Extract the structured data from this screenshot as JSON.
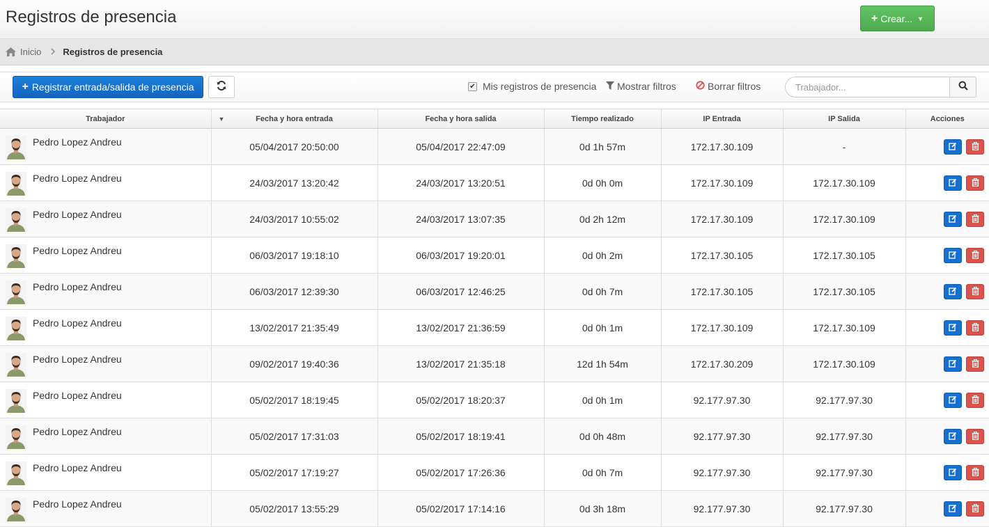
{
  "header": {
    "title": "Registros de presencia",
    "create_label": "Crear..."
  },
  "breadcrumb": {
    "home": "Inicio",
    "current": "Registros de presencia"
  },
  "toolbar": {
    "register_label": "Registrar entrada/salida de presencia",
    "my_records_label": "Mis registros de presencia",
    "my_records_checked": true,
    "show_filters_label": "Mostrar filtros",
    "clear_filters_label": "Borrar filtros",
    "search_placeholder": "Trabajador..."
  },
  "table": {
    "columns": [
      "Trabajador",
      "Fecha y hora entrada",
      "Fecha y hora salida",
      "Tiempo realizado",
      "IP Entrada",
      "IP Salida",
      "Acciones"
    ],
    "rows": [
      {
        "worker": "Pedro Lopez Andreu",
        "entry": "05/04/2017 20:50:00",
        "exit": "05/04/2017 22:47:09",
        "time": "0d 1h 57m",
        "ip_in": "172.17.30.109",
        "ip_out": "-"
      },
      {
        "worker": "Pedro Lopez Andreu",
        "entry": "24/03/2017 13:20:42",
        "exit": "24/03/2017 13:20:51",
        "time": "0d 0h 0m",
        "ip_in": "172.17.30.109",
        "ip_out": "172.17.30.109"
      },
      {
        "worker": "Pedro Lopez Andreu",
        "entry": "24/03/2017 10:55:02",
        "exit": "24/03/2017 13:07:35",
        "time": "0d 2h 12m",
        "ip_in": "172.17.30.109",
        "ip_out": "172.17.30.109"
      },
      {
        "worker": "Pedro Lopez Andreu",
        "entry": "06/03/2017 19:18:10",
        "exit": "06/03/2017 19:20:01",
        "time": "0d 0h 2m",
        "ip_in": "172.17.30.105",
        "ip_out": "172.17.30.105"
      },
      {
        "worker": "Pedro Lopez Andreu",
        "entry": "06/03/2017 12:39:30",
        "exit": "06/03/2017 12:46:25",
        "time": "0d 0h 7m",
        "ip_in": "172.17.30.105",
        "ip_out": "172.17.30.105"
      },
      {
        "worker": "Pedro Lopez Andreu",
        "entry": "13/02/2017 21:35:49",
        "exit": "13/02/2017 21:36:59",
        "time": "0d 0h 1m",
        "ip_in": "172.17.30.109",
        "ip_out": "172.17.30.109"
      },
      {
        "worker": "Pedro Lopez Andreu",
        "entry": "09/02/2017 19:40:36",
        "exit": "13/02/2017 21:35:18",
        "time": "12d 1h 54m",
        "ip_in": "172.17.30.209",
        "ip_out": "172.17.30.109"
      },
      {
        "worker": "Pedro Lopez Andreu",
        "entry": "05/02/2017 18:19:45",
        "exit": "05/02/2017 18:20:37",
        "time": "0d 0h 1m",
        "ip_in": "92.177.97.30",
        "ip_out": "92.177.97.30"
      },
      {
        "worker": "Pedro Lopez Andreu",
        "entry": "05/02/2017 17:31:03",
        "exit": "05/02/2017 18:19:41",
        "time": "0d 0h 48m",
        "ip_in": "92.177.97.30",
        "ip_out": "92.177.97.30"
      },
      {
        "worker": "Pedro Lopez Andreu",
        "entry": "05/02/2017 17:19:27",
        "exit": "05/02/2017 17:26:36",
        "time": "0d 0h 7m",
        "ip_in": "92.177.97.30",
        "ip_out": "92.177.97.30"
      },
      {
        "worker": "Pedro Lopez Andreu",
        "entry": "05/02/2017 13:55:29",
        "exit": "05/02/2017 17:14:16",
        "time": "0d 3h 18m",
        "ip_in": "92.177.97.30",
        "ip_out": "92.177.97.30"
      }
    ]
  },
  "colors": {
    "primary": "#1565c0",
    "success": "#4fa94f",
    "danger": "#d9534f"
  },
  "icons": {
    "home": "home-icon",
    "refresh": "refresh-icon",
    "filter": "filter-icon",
    "clear": "ban-icon",
    "search": "search-icon",
    "edit": "edit-icon",
    "delete": "trash-icon",
    "avatar": "avatar"
  }
}
